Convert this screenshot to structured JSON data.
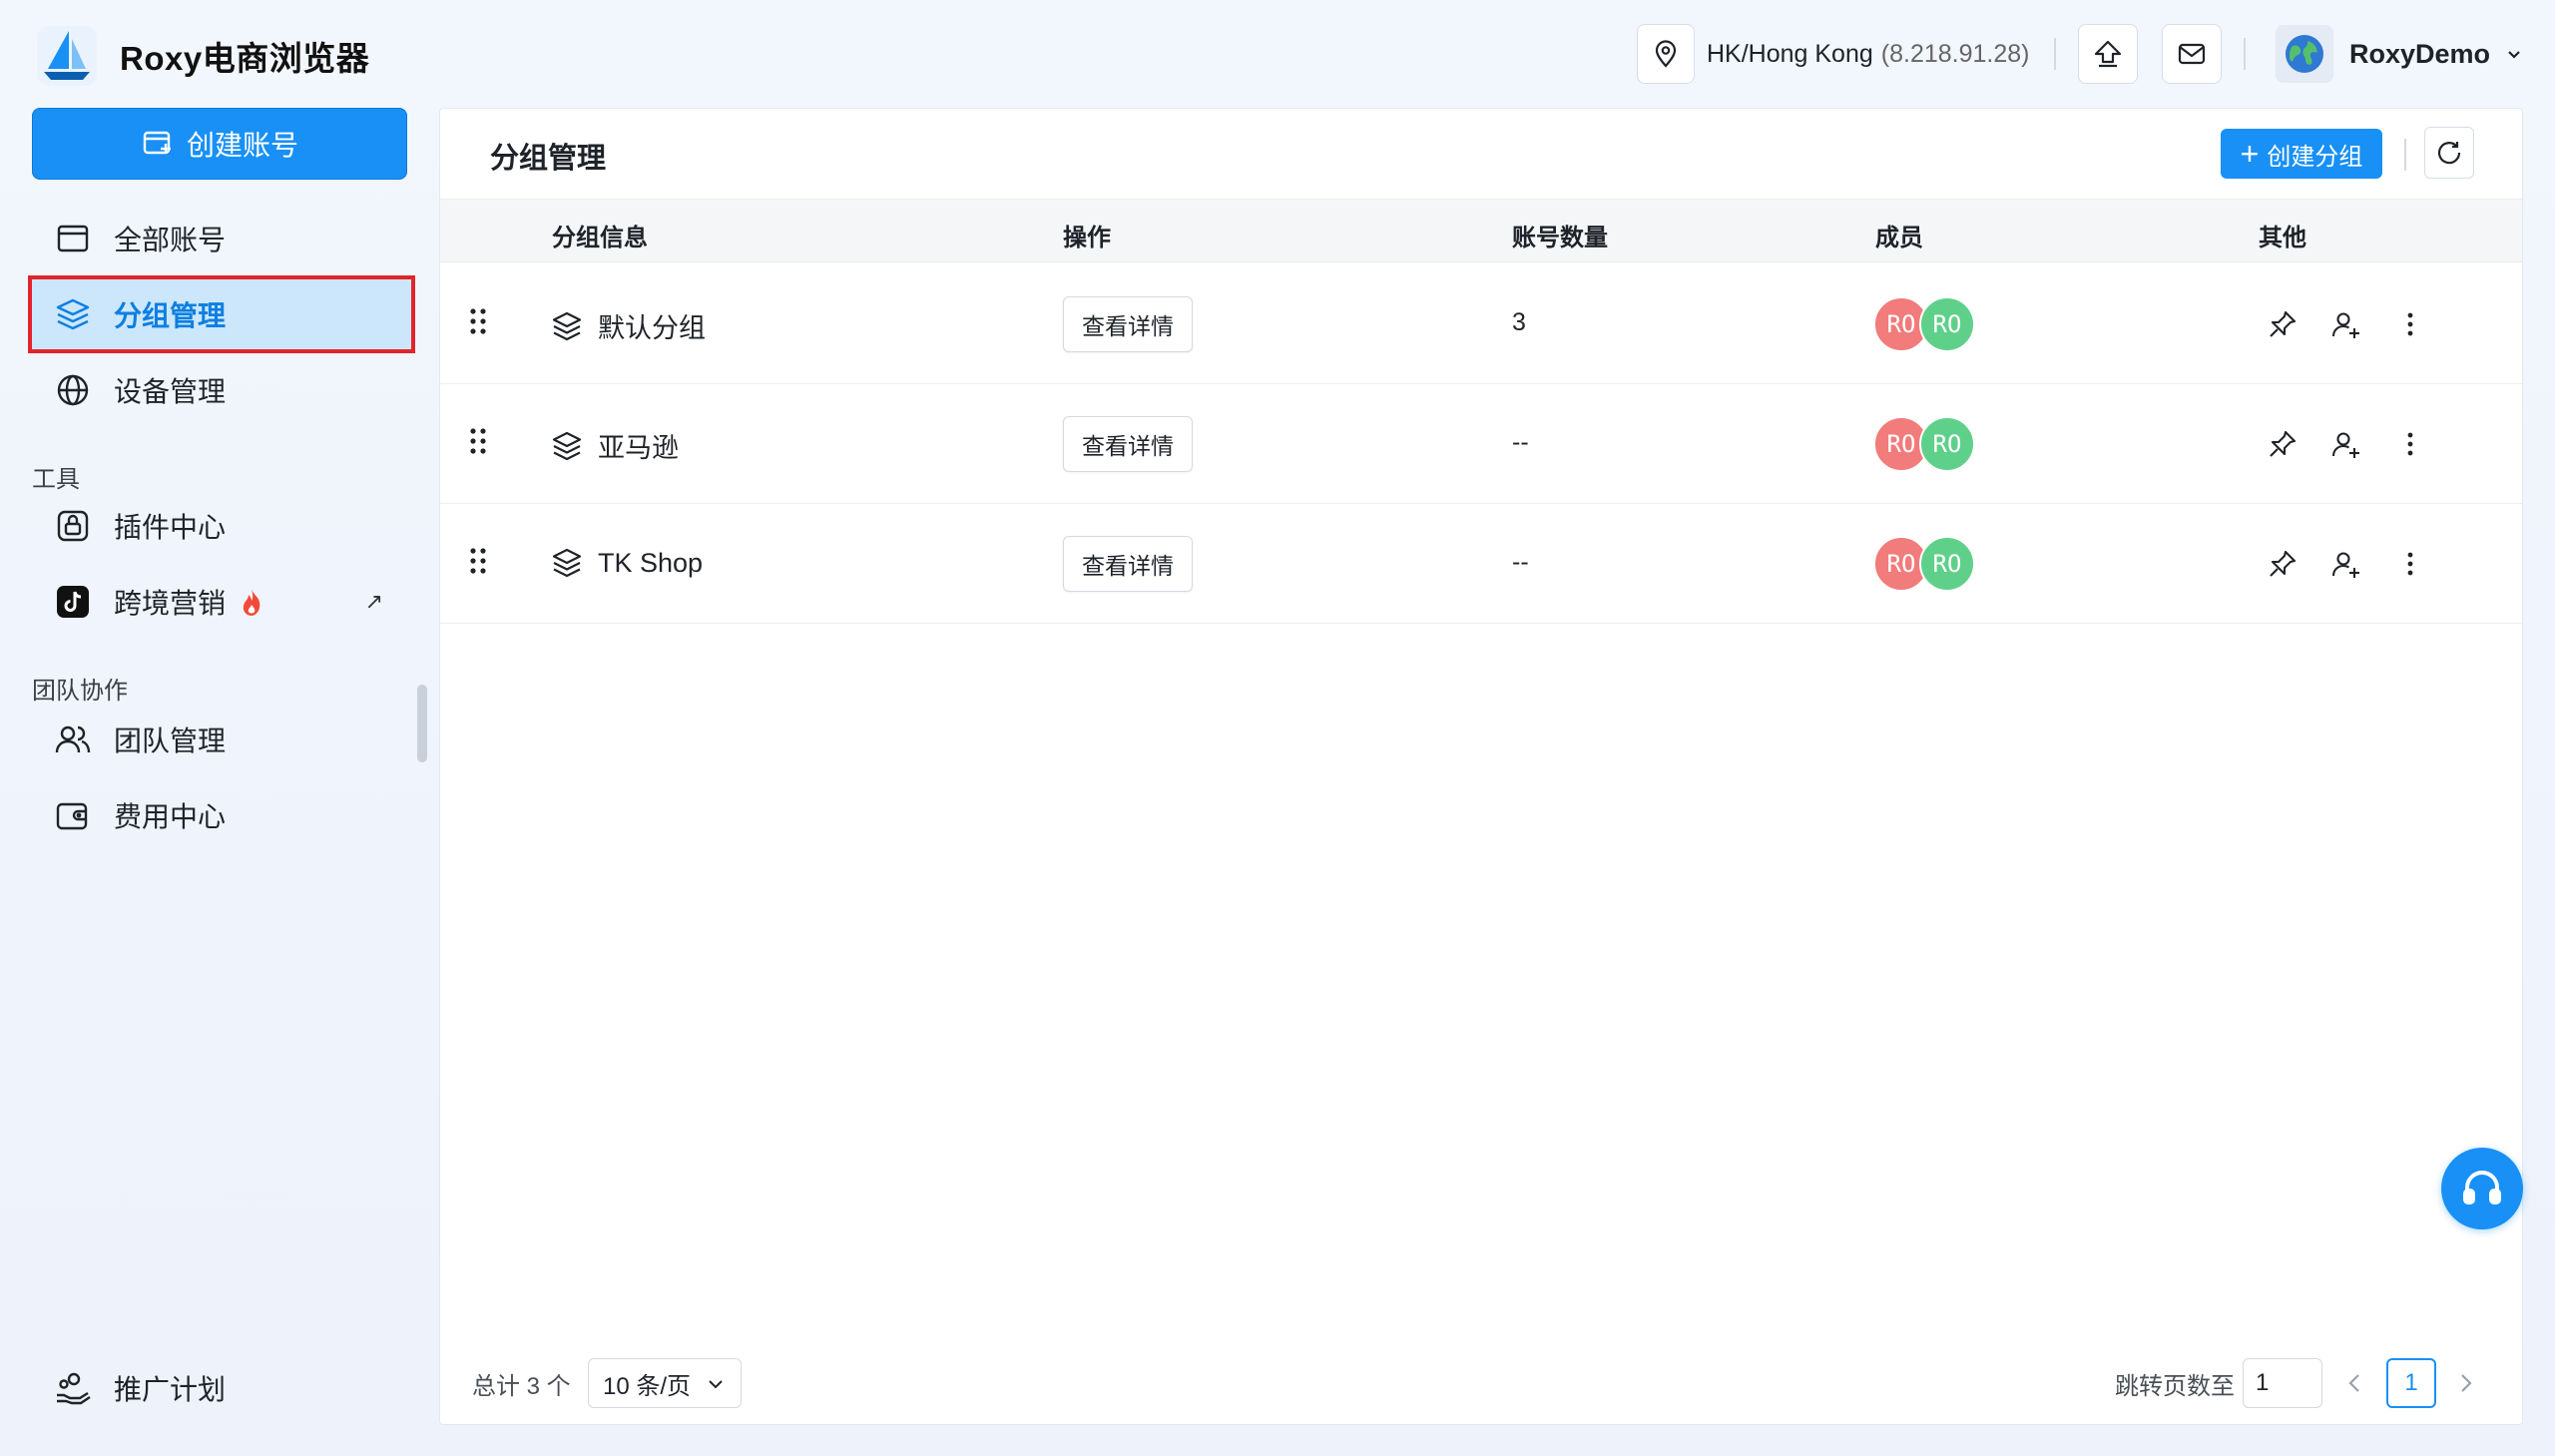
{
  "app": {
    "brand_title": "Roxy电商浏览器"
  },
  "sidebar": {
    "create_button": "创建账号",
    "items": [
      {
        "label": "全部账号",
        "icon": "window-icon"
      },
      {
        "label": "分组管理",
        "icon": "layers-icon",
        "active": true
      },
      {
        "label": "设备管理",
        "icon": "globe-icon"
      }
    ],
    "section_tools": "工具",
    "tools": [
      {
        "label": "插件中心",
        "icon": "plugin-icon"
      },
      {
        "label": "跨境营销",
        "icon": "tiktok-icon",
        "badge": "fire-icon",
        "external": "↗"
      }
    ],
    "section_team": "团队协作",
    "team": [
      {
        "label": "团队管理",
        "icon": "users-icon"
      },
      {
        "label": "费用中心",
        "icon": "wallet-icon"
      }
    ],
    "bottom": {
      "label": "推广计划",
      "icon": "gift-icon"
    }
  },
  "topbar": {
    "location": "HK/Hong Kong",
    "ip": "(8.218.91.28)",
    "username": "RoxyDemo"
  },
  "panel": {
    "title": "分组管理",
    "create_group_button": "创建分组",
    "columns": [
      "分组信息",
      "操作",
      "账号数量",
      "成员",
      "其他"
    ],
    "rows": [
      {
        "name": "默认分组",
        "action": "查看详情",
        "count": "3",
        "members": [
          "RO",
          "RO"
        ]
      },
      {
        "name": "亚马逊",
        "action": "查看详情",
        "count": "--",
        "members": [
          "RO",
          "RO"
        ]
      },
      {
        "name": "TK Shop",
        "action": "查看详情",
        "count": "--",
        "members": [
          "RO",
          "RO"
        ]
      }
    ],
    "footer": {
      "total": "总计 3 个",
      "page_size": "10 条/页",
      "jump_label": "跳转页数至",
      "jump_value": "1",
      "current_page": "1"
    }
  },
  "colors": {
    "accent": "#1890f5",
    "member_red": "#f27b7b",
    "member_green": "#5fd08a",
    "highlight_border": "#e0262b"
  }
}
